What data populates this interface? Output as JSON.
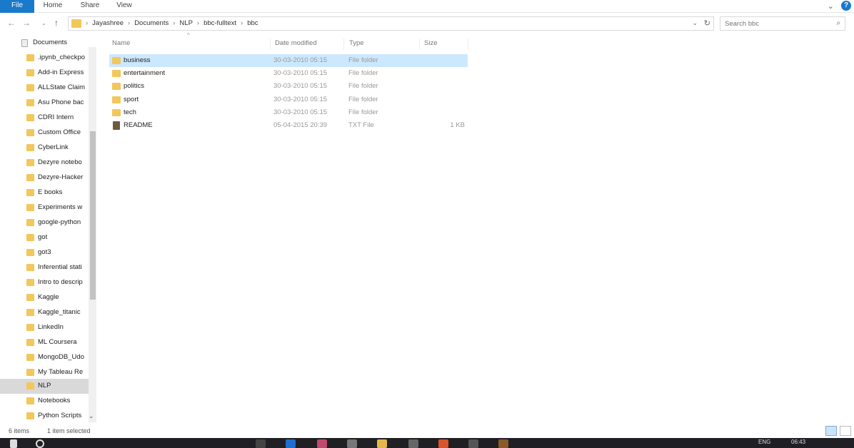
{
  "ribbon": {
    "tabs": [
      "File",
      "Home",
      "Share",
      "View"
    ]
  },
  "address": {
    "crumbs": [
      "Jayashree",
      "Documents",
      "NLP",
      "bbc-fulltext",
      "bbc"
    ],
    "separator": "›"
  },
  "search": {
    "placeholder": "Search bbc"
  },
  "sidebar": {
    "root": "Documents",
    "items": [
      ".ipynb_checkpo",
      "Add-in Express",
      "ALLState Claim",
      "Asu Phone bac",
      "CDRI Intern",
      "Custom Office",
      "CyberLink",
      "Dezyre notebo",
      "Dezyre-Hacker",
      "E books",
      "Experiments w",
      "google-python",
      "got",
      "got3",
      "Inferential stati",
      "Intro to descrip",
      "Kaggle",
      "Kaggle_titanic",
      "LinkedIn",
      "ML Coursera",
      "MongoDB_Udo",
      "My Tableau Re",
      "NLP",
      "Notebooks",
      "Python Scripts"
    ],
    "selected": "NLP"
  },
  "columns": {
    "name": "Name",
    "date": "Date modified",
    "type": "Type",
    "size": "Size"
  },
  "files": [
    {
      "name": "business",
      "date": "30-03-2010 05:15",
      "type": "File folder",
      "size": "",
      "kind": "folder",
      "selected": true
    },
    {
      "name": "entertainment",
      "date": "30-03-2010 05:15",
      "type": "File folder",
      "size": "",
      "kind": "folder"
    },
    {
      "name": "politics",
      "date": "30-03-2010 05:15",
      "type": "File folder",
      "size": "",
      "kind": "folder"
    },
    {
      "name": "sport",
      "date": "30-03-2010 05:15",
      "type": "File folder",
      "size": "",
      "kind": "folder"
    },
    {
      "name": "tech",
      "date": "30-03-2010 05:15",
      "type": "File folder",
      "size": "",
      "kind": "folder"
    },
    {
      "name": "README",
      "date": "05-04-2015 20:39",
      "type": "TXT File",
      "size": "1 KB",
      "kind": "txt"
    }
  ],
  "status": {
    "count": "6 items",
    "selection": "1 item selected"
  },
  "taskbar": {
    "lang": "ENG",
    "time": "06:43"
  },
  "colors": {
    "accent": "#1979ca",
    "selection": "#cce8ff",
    "folder": "#f2c75c"
  }
}
